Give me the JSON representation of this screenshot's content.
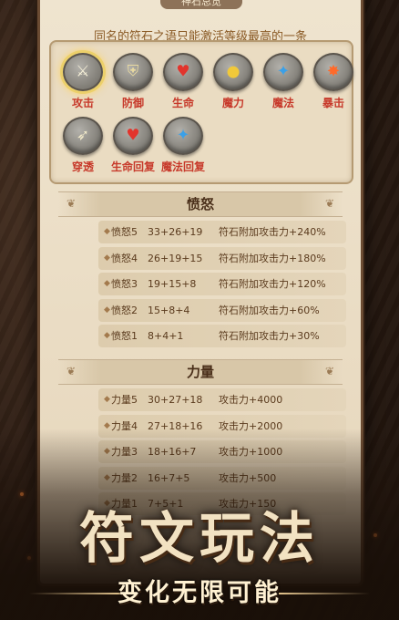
{
  "header": {
    "tab_label": "神石总览",
    "notice": "同名的符石之语只能激活等级最高的一条"
  },
  "runes": [
    {
      "label": "攻击",
      "icon": "sword-icon",
      "glyph": "⚔",
      "color": "#f6f0d8",
      "selected": true
    },
    {
      "label": "防御",
      "icon": "shield-icon",
      "glyph": "⛨",
      "color": "#e8d9a0",
      "selected": false
    },
    {
      "label": "生命",
      "icon": "heart-icon",
      "glyph": "♥",
      "color": "#e2342c",
      "selected": false
    },
    {
      "label": "魔力",
      "icon": "mana-orb-icon",
      "glyph": "●",
      "color": "#f1c93a",
      "selected": false
    },
    {
      "label": "魔法",
      "icon": "magic-icon",
      "glyph": "✦",
      "color": "#3aa0e8",
      "selected": false
    },
    {
      "label": "暴击",
      "icon": "crit-flame-icon",
      "glyph": "✸",
      "color": "#ff6a2a",
      "selected": false
    },
    {
      "label": "穿透",
      "icon": "pierce-icon",
      "glyph": "➶",
      "color": "#f1e9c9",
      "selected": false
    },
    {
      "label": "生命回复",
      "icon": "heart-regen-icon",
      "glyph": "♥",
      "color": "#e2342c",
      "selected": false
    },
    {
      "label": "魔法回复",
      "icon": "magic-regen-icon",
      "glyph": "✦",
      "color": "#3aa0e8",
      "selected": false
    }
  ],
  "sections": [
    {
      "title": "愤怒",
      "rows": [
        {
          "name": "愤怒5",
          "values": "33+26+19",
          "effect": "符石附加攻击力+240%"
        },
        {
          "name": "愤怒4",
          "values": "26+19+15",
          "effect": "符石附加攻击力+180%"
        },
        {
          "name": "愤怒3",
          "values": "19+15+8",
          "effect": "符石附加攻击力+120%"
        },
        {
          "name": "愤怒2",
          "values": "15+8+4",
          "effect": "符石附加攻击力+60%"
        },
        {
          "name": "愤怒1",
          "values": "8+4+1",
          "effect": "符石附加攻击力+30%"
        }
      ]
    },
    {
      "title": "力量",
      "rows": [
        {
          "name": "力量5",
          "values": "30+27+18",
          "effect": "攻击力+4000"
        },
        {
          "name": "力量4",
          "values": "27+18+16",
          "effect": "攻击力+2000"
        },
        {
          "name": "力量3",
          "values": "18+16+7",
          "effect": "攻击力+1000"
        },
        {
          "name": "力量2",
          "values": "16+7+5",
          "effect": "攻击力+500"
        },
        {
          "name": "力量1",
          "values": "7+5+1",
          "effect": "攻击力+150"
        }
      ]
    }
  ],
  "promo": {
    "title": "符文玩法",
    "subtitle": "变化无限可能"
  }
}
